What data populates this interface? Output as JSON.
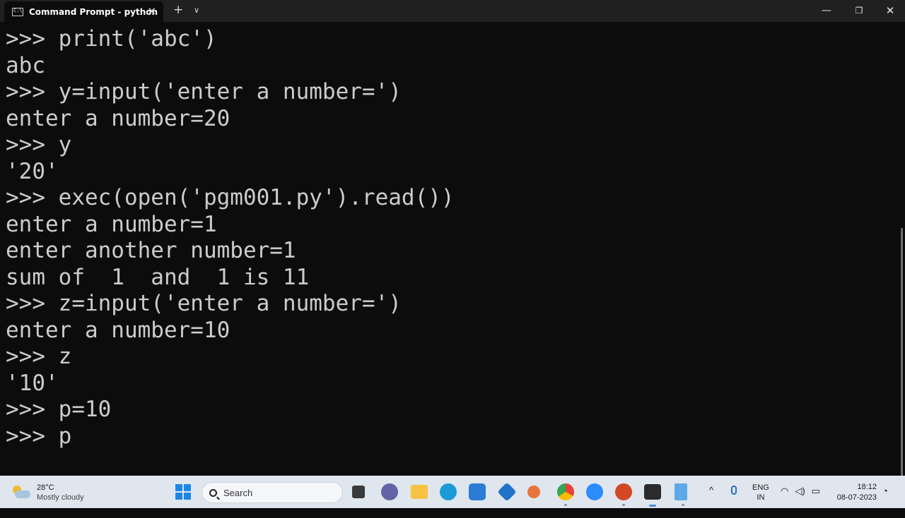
{
  "window": {
    "tab_title": "Command Prompt - python",
    "tab_close": "✕",
    "new_tab": "+",
    "tab_dropdown": "∨",
    "minimize": "—",
    "maximize": "❐",
    "close": "✕"
  },
  "console": {
    "lines": [
      ">>> print('abc')",
      "abc",
      ">>> y=input('enter a number=')",
      "enter a number=20",
      ">>> y",
      "'20'",
      ">>> exec(open('pgm001.py').read())",
      "enter a number=1",
      "enter another number=1",
      "sum of  1  and  1 is 11",
      ">>> z=input('enter a number=')",
      "enter a number=10",
      ">>> z",
      "'10'",
      ">>> p=10",
      ">>> p"
    ]
  },
  "taskbar": {
    "weather": {
      "temp": "28°C",
      "condition": "Mostly cloudy"
    },
    "search_placeholder": "Search",
    "apps": [
      {
        "name": "file-manager-icon",
        "color": "#3a3a3a"
      },
      {
        "name": "chat-icon",
        "color": "#6264a7"
      },
      {
        "name": "file-explorer-icon",
        "color": "#f6c343"
      },
      {
        "name": "edge-icon",
        "color": "#1a9bd7"
      },
      {
        "name": "store-icon",
        "color": "#2b7cd3"
      },
      {
        "name": "code-icon",
        "color": "#1f74c9"
      },
      {
        "name": "python-idle-icon",
        "color": "#e8743b"
      },
      {
        "name": "chrome-icon",
        "color": "#34a853"
      },
      {
        "name": "zoom-icon",
        "color": "#2d8cff"
      },
      {
        "name": "powerpoint-icon",
        "color": "#d24726"
      },
      {
        "name": "terminal-icon",
        "color": "#2b2b2b"
      },
      {
        "name": "notepad-icon",
        "color": "#5fa8e8"
      }
    ],
    "tray": {
      "chevron": "^",
      "lang_top": "ENG",
      "lang_bottom": "IN",
      "time": "18:12",
      "date": "08-07-2023"
    }
  }
}
